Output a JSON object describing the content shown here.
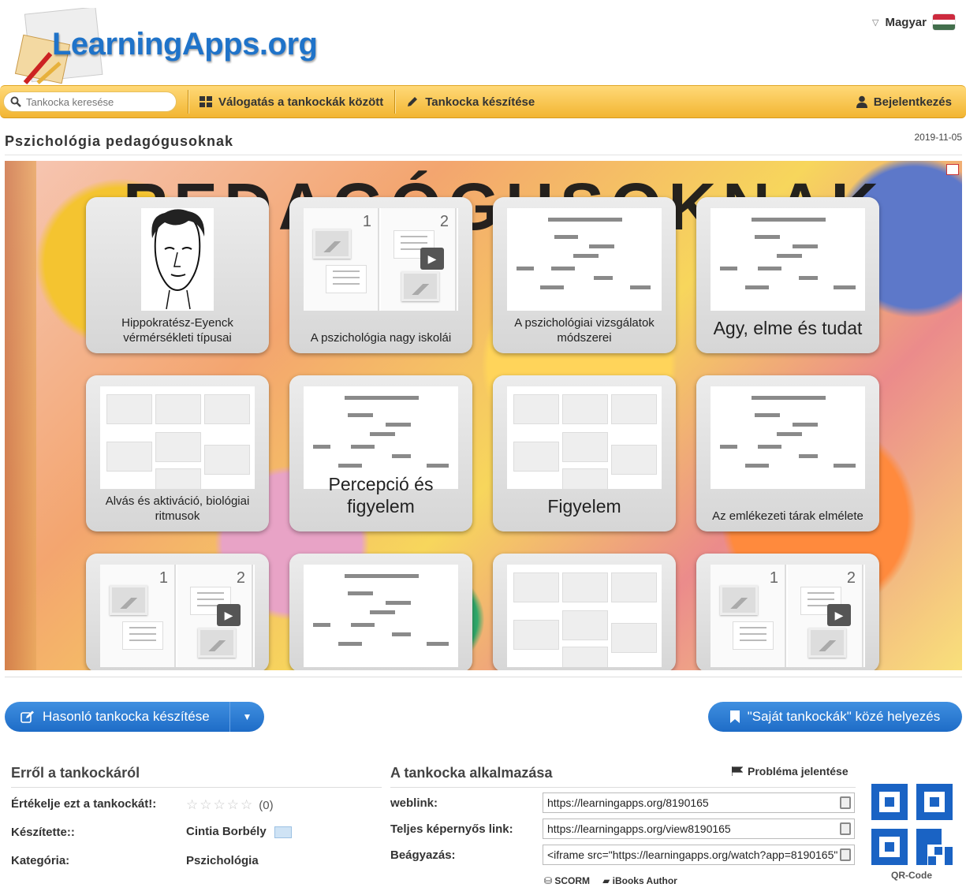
{
  "header": {
    "logo_text": "LearningApps.org",
    "language": "Magyar"
  },
  "nav": {
    "search_placeholder": "Tankocka keresése",
    "browse": "Válogatás a tankockák között",
    "create": "Tankocka készítése",
    "login": "Bejelentkezés"
  },
  "page": {
    "title": "Pszichológia pedagógusoknak",
    "date": "2019-11-05",
    "board_heading": "PEDAGÓGUSOKNAK"
  },
  "cards": [
    {
      "label": "Hippokratész-Eyenck vérmérsékleti típusai",
      "thumb": "portrait"
    },
    {
      "label": "A pszichológia nagy iskolái",
      "thumb": "two-part"
    },
    {
      "label": "A pszichológiai vizsgálatok módszerei",
      "thumb": "bars"
    },
    {
      "label": "Agy, elme és tudat",
      "thumb": "bars"
    },
    {
      "label": "Alvás és aktiváció, biológiai ritmusok",
      "thumb": "grid"
    },
    {
      "label": "Percepció és figyelem",
      "thumb": "bars"
    },
    {
      "label": "Figyelem",
      "thumb": "grid"
    },
    {
      "label": "Az emlékezeti tárak elmélete",
      "thumb": "bars"
    },
    {
      "label": "",
      "thumb": "two-part"
    },
    {
      "label": "",
      "thumb": "bars"
    },
    {
      "label": "",
      "thumb": "grid"
    },
    {
      "label": "",
      "thumb": "two-part"
    }
  ],
  "actions": {
    "similar": "Hasonló tankocka készítése",
    "save": "\"Saját tankockák\" közé helyezés"
  },
  "about": {
    "title": "Erről a tankockáról",
    "rate_label": "Értékelje ezt a tankockát!:",
    "rating_count": "(0)",
    "rating_stars": 0,
    "author_label": "Készítette::",
    "author": "Cintia Borbély",
    "category_label": "Kategória:",
    "category": "Pszichológia"
  },
  "usage": {
    "title": "A tankocka alkalmazása",
    "report": "Probléma jelentése",
    "weblink_label": "weblink:",
    "weblink": "https://learningapps.org/8190165",
    "fullscreen_label": "Teljes képernyős link:",
    "fullscreen": "https://learningapps.org/view8190165",
    "embed_label": "Beágyazás:",
    "embed": "<iframe src=\"https://learningapps.org/watch?app=8190165\"",
    "scorm": "SCORM",
    "ibooks": "iBooks Author",
    "qr_label": "QR-Code"
  },
  "colors": {
    "brand_blue": "#1f73c9",
    "nav_yellow": "#f2b532",
    "button_blue": "#1e6cc7"
  }
}
